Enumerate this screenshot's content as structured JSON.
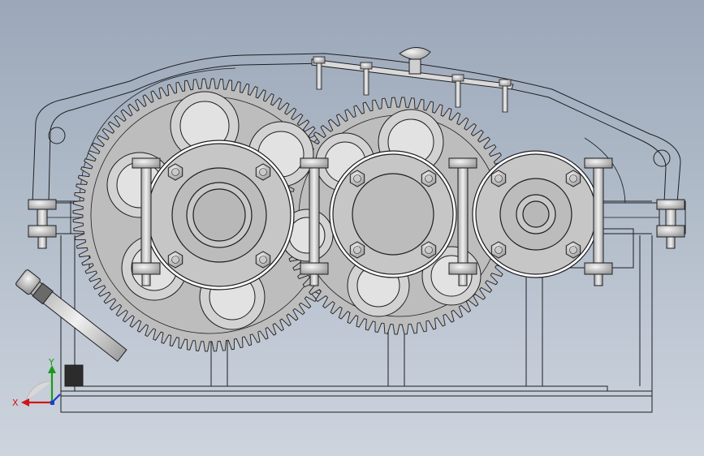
{
  "viewport": {
    "background_top": "#9ba8b9",
    "background_bottom": "#cdd4de"
  },
  "colors": {
    "line": "#1e1e22",
    "gear_fill": "#bdbdbd",
    "flange_fill": "#c4c4c4",
    "bolt_fill": "#d6d6d6",
    "axis_x": "#d01515",
    "axis_y": "#1a9a1a",
    "axis_z": "#1a3fd0"
  },
  "triad": {
    "x_label": "X",
    "y_label": "Y"
  }
}
